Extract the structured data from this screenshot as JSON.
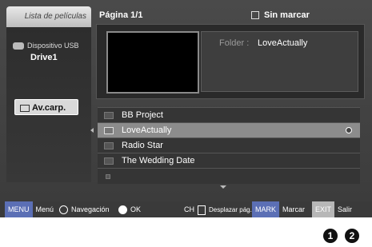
{
  "sidebar": {
    "tab_label": "Lista de películas",
    "usb_label": "Dispositivo USB",
    "drive_label": "Drive1",
    "avcarp_label": "Av.carp."
  },
  "header": {
    "page_label": "Página",
    "page_value": "1/1",
    "mark_label": "Sin marcar"
  },
  "panel": {
    "folder_label": "Folder",
    "folder_value": "LoveActually"
  },
  "list": {
    "items": [
      {
        "name": "BB Project"
      },
      {
        "name": "LoveActually",
        "selected": true
      },
      {
        "name": "Radio Star"
      },
      {
        "name": "The Wedding Date"
      },
      {
        "name": ""
      }
    ]
  },
  "bottom": {
    "menu_btn": "MENU",
    "menu_text": "Menú",
    "nav_text": "Navegación",
    "ok_text": "OK",
    "ch_text": "CH",
    "ch_sub": "Desplazar pág.",
    "mark_btn": "MARK",
    "mark_text": "Marcar",
    "exit_btn": "EXIT",
    "exit_text": "Salir"
  },
  "badges": [
    "1",
    "2"
  ],
  "colors": {
    "screen_bg": "#3c3c3c",
    "button_blue": "#5b6fb5",
    "selection": "#8c8c8c"
  }
}
